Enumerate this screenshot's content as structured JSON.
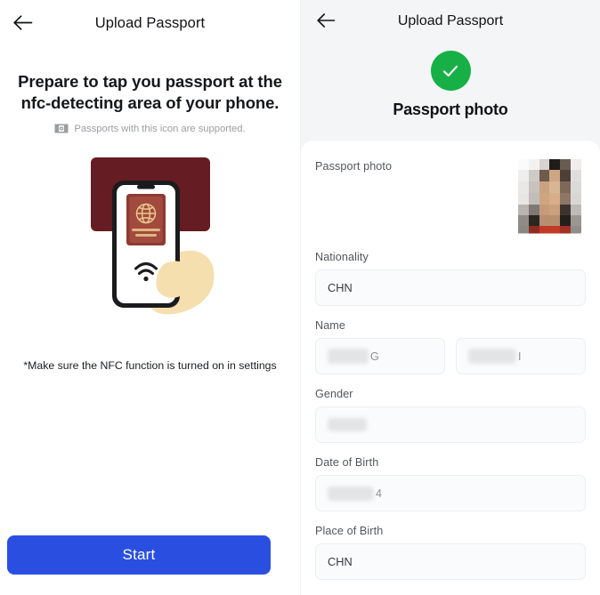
{
  "left_screen": {
    "nav": {
      "back_icon": "arrow-left-icon",
      "title": "Upload Passport"
    },
    "lead_text": "Prepare to tap you passport at the nfc-detecting area of your phone.",
    "supported_icon": "e-passport-icon",
    "supported_text": "Passports with this icon are supported.",
    "illustration": {
      "name": "nfc-tap-illustration",
      "reader_color": "#651C22",
      "phone_body_color": "#1B1B1D",
      "phone_screen_color": "#FFFFFF",
      "passport_color": "#8E3A33",
      "hand_color": "#F5DFAF",
      "wifi_icon": "nfc-wave-icon",
      "globe_icon": "globe-emblem-icon"
    },
    "note": "*Make sure the NFC function is turned on in settings",
    "start_button": {
      "label": "Start",
      "color": "#2A4FE0",
      "text_color": "#FFFFFF"
    }
  },
  "right_screen": {
    "nav": {
      "back_icon": "arrow-left-icon",
      "title": "Upload Passport"
    },
    "status": {
      "icon": "check-circle-icon",
      "icon_color": "#16B046",
      "label": "Passport photo"
    },
    "fields": [
      {
        "label": "Passport photo",
        "type": "photo",
        "value": "",
        "redacted": true,
        "name": "passport-photo-thumbnail"
      },
      {
        "label": "Nationality",
        "type": "text",
        "value": "CHN",
        "redacted": false,
        "name": "nationality-input"
      },
      {
        "label": "Name",
        "type": "text-pair",
        "value_first": "G",
        "value_second": "I",
        "redacted": true,
        "name": "name-input"
      },
      {
        "label": "Gender",
        "type": "text",
        "value": "",
        "redacted": true,
        "name": "gender-input"
      },
      {
        "label": "Date of Birth",
        "type": "text",
        "value": "4",
        "redacted": true,
        "name": "date-of-birth-input"
      },
      {
        "label": "Place of Birth",
        "type": "text",
        "value": "CHN",
        "redacted": false,
        "name": "place-of-birth-input"
      }
    ]
  }
}
